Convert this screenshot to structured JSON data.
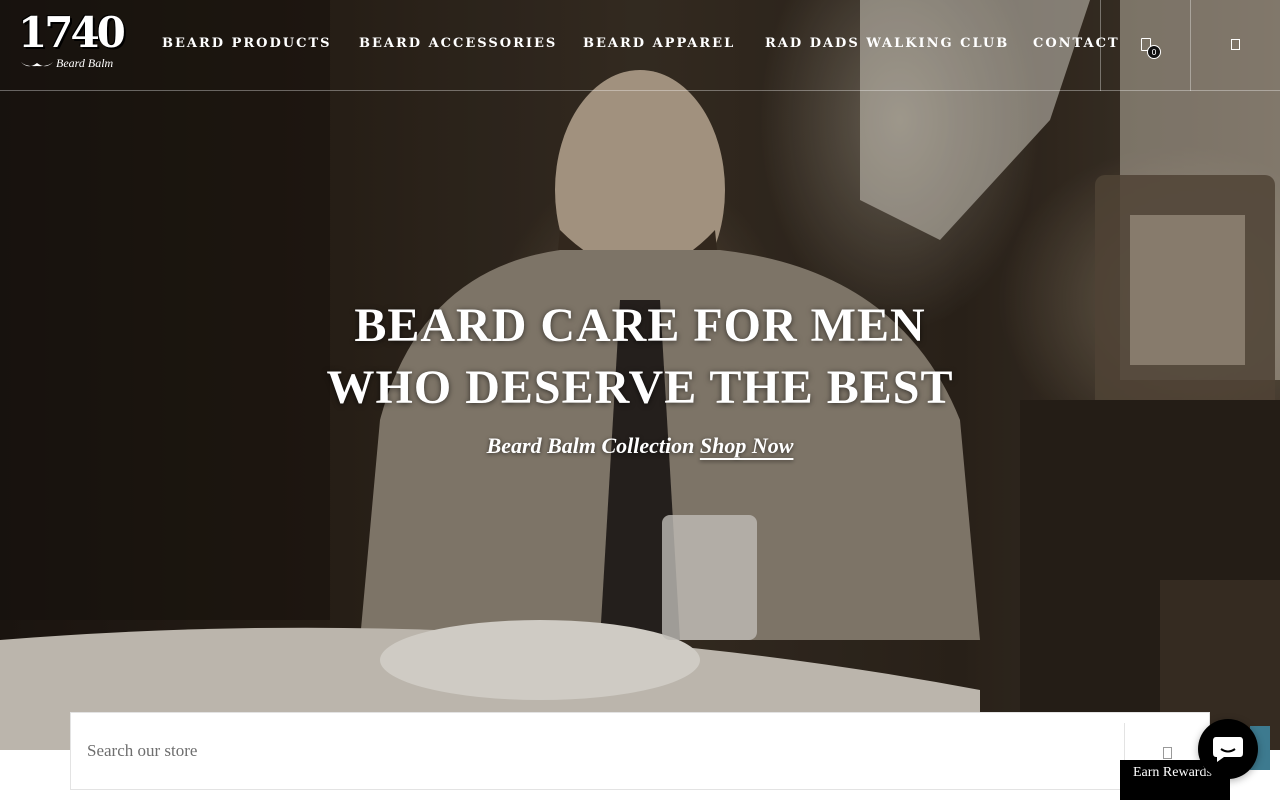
{
  "header": {
    "logo": {
      "number": "1740",
      "subtitle": "Beard Balm"
    },
    "nav": [
      {
        "label": "BEARD PRODUCTS"
      },
      {
        "label": "BEARD ACCESSORIES"
      },
      {
        "label": "BEARD APPAREL"
      },
      {
        "label": "RAD DADS WALKING CLUB"
      },
      {
        "label": "CONTACT"
      }
    ],
    "cart": {
      "icon": "cart-icon",
      "count": "0"
    },
    "account": {
      "icon": "account-icon"
    }
  },
  "hero": {
    "title_line1": "BEARD CARE FOR MEN",
    "title_line2": "WHO DESERVE THE BEST",
    "subtitle": "Beard Balm Collection",
    "cta": "Shop Now"
  },
  "search": {
    "placeholder": "Search our store",
    "icon": "search-icon"
  },
  "rewards": {
    "label": "Earn Rewards"
  },
  "chat": {
    "icon": "chat-icon",
    "accent": "#3d7a8f"
  }
}
